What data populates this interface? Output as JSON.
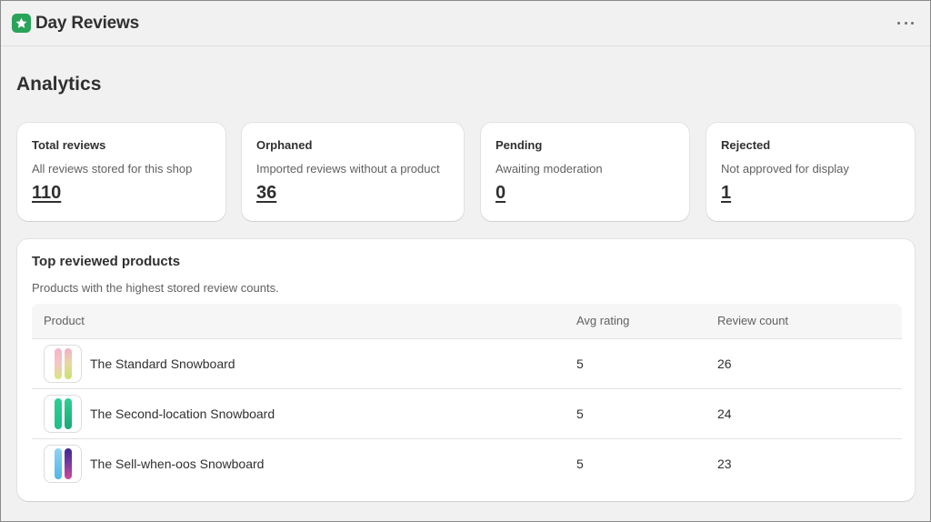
{
  "app": {
    "title": "Day Reviews",
    "icon": "star-icon",
    "accent": "#29a35a"
  },
  "page": {
    "title": "Analytics"
  },
  "stats": [
    {
      "title": "Total reviews",
      "description": "All reviews stored for this shop",
      "value": "110"
    },
    {
      "title": "Orphaned",
      "description": "Imported reviews without a product",
      "value": "36"
    },
    {
      "title": "Pending",
      "description": "Awaiting moderation",
      "value": "0"
    },
    {
      "title": "Rejected",
      "description": "Not approved for display",
      "value": "1"
    }
  ],
  "top_products": {
    "title": "Top reviewed products",
    "description": "Products with the highest stored review counts.",
    "columns": [
      "Product",
      "Avg rating",
      "Review count"
    ],
    "rows": [
      {
        "name": "The Standard Snowboard",
        "rating": "5",
        "count": "26",
        "thumb_colors": [
          "#f3b7c8",
          "#d8e87a"
        ]
      },
      {
        "name": "The Second-location Snowboard",
        "rating": "5",
        "count": "24",
        "thumb_colors": [
          "#2fcf93",
          "#1fbf86"
        ]
      },
      {
        "name": "The Sell-when-oos Snowboard",
        "rating": "5",
        "count": "23",
        "thumb_colors": [
          "#6fc7ee",
          "#5b2b8f"
        ]
      }
    ]
  }
}
